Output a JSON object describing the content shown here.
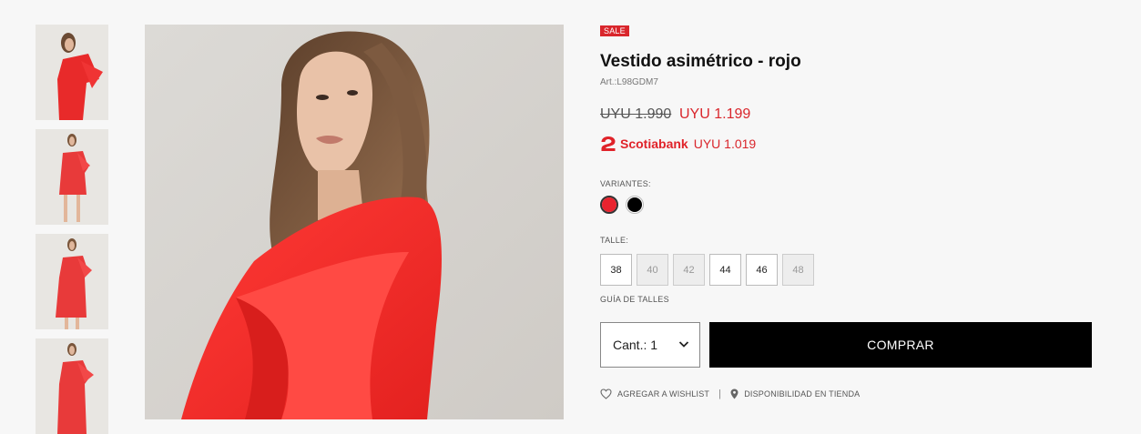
{
  "product": {
    "badge": "SALE",
    "title": "Vestido asimétrico - rojo",
    "sku": "Art.:L98GDM7",
    "price_old": "UYU 1.990",
    "price_new": "UYU 1.199",
    "bank_name": "Scotiabank",
    "bank_price": "UYU 1.019",
    "accent_color": "#d9262c"
  },
  "variants": {
    "label": "VARIANTES:",
    "colors": [
      "#e8232e",
      "#000000"
    ],
    "selected": 0
  },
  "sizes": {
    "label": "TALLE:",
    "options": [
      {
        "label": "38",
        "available": true
      },
      {
        "label": "40",
        "available": false
      },
      {
        "label": "42",
        "available": false
      },
      {
        "label": "44",
        "available": true
      },
      {
        "label": "46",
        "available": true
      },
      {
        "label": "48",
        "available": false
      }
    ],
    "guide": "GUÍA DE TALLES"
  },
  "purchase": {
    "qty_label": "Cant.: 1",
    "buy_label": "COMPRAR"
  },
  "links": {
    "wishlist": "AGREGAR A WISHLIST",
    "separator": "|",
    "availability": "DISPONIBILIDAD EN TIENDA"
  },
  "icons": [
    "heart-icon",
    "location-pin-icon",
    "chevron-down-icon",
    "scotiabank-logo-icon"
  ]
}
